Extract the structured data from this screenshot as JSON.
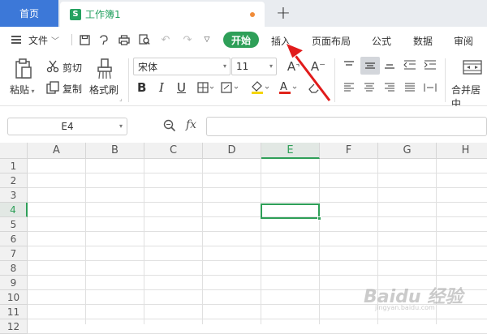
{
  "titlebar": {
    "home_tab": "首页",
    "file_icon": "S",
    "file_tab": "工作簿1",
    "new_tab": "+"
  },
  "menubar": {
    "file_menu": "文件",
    "start_button": "开始",
    "tabs": [
      "插入",
      "页面布局",
      "公式",
      "数据",
      "审阅"
    ]
  },
  "ribbon": {
    "paste": "粘贴",
    "cut": "剪切",
    "copy": "复制",
    "format_painter": "格式刷",
    "font_name": "宋体",
    "font_size": "11",
    "merge_center": "合并居中",
    "increase_font": "A⁺",
    "decrease_font": "A⁻"
  },
  "formula_bar": {
    "name_box": "E4",
    "fx": "fx",
    "formula_value": ""
  },
  "sheet": {
    "columns": [
      "A",
      "B",
      "C",
      "D",
      "E",
      "F",
      "G",
      "H"
    ],
    "rows": [
      "1",
      "2",
      "3",
      "4",
      "5",
      "6",
      "7",
      "8",
      "9",
      "10",
      "11",
      "12"
    ],
    "selected_cell": "E4"
  },
  "watermark": {
    "text": "Baidu 经验",
    "sub": "jingyan.baidu.com"
  },
  "colors": {
    "accent_green": "#2e9f58",
    "home_tab_blue": "#3c78d8",
    "annotation_red": "#e11b1b"
  }
}
